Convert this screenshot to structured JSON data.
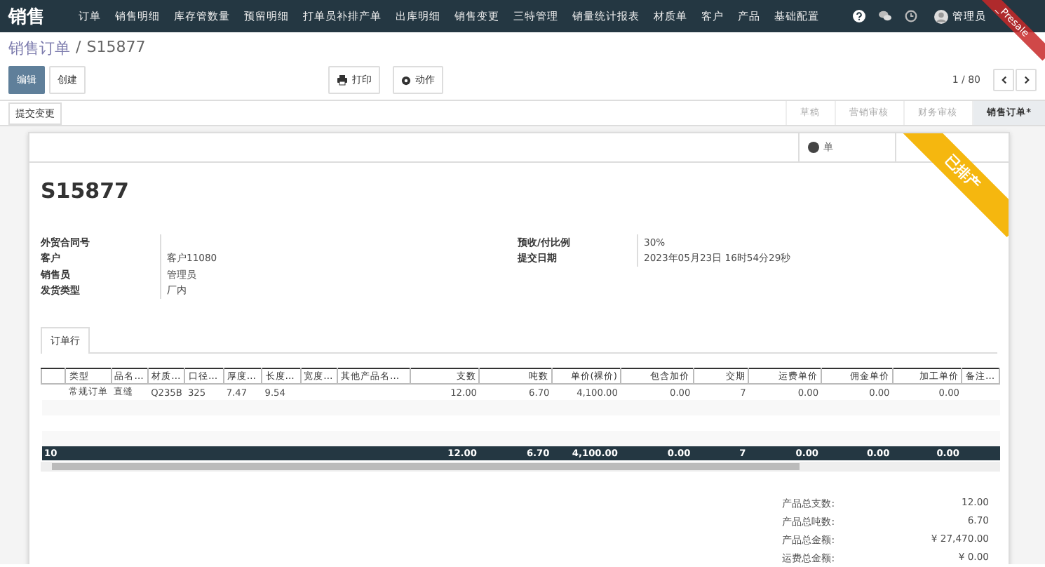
{
  "navbar": {
    "brand": "销售",
    "menu": [
      "订单",
      "销售明细",
      "库存管数量",
      "预留明细",
      "打单员补排产单",
      "出库明细",
      "销售变更",
      "三特管理",
      "销量统计报表",
      "材质单",
      "客户",
      "产品",
      "基础配置"
    ],
    "user": "管理员",
    "ribbon": "_Presale"
  },
  "breadcrumb": {
    "parent": "销售订单",
    "separator": "/",
    "current": "S15877"
  },
  "buttons": [
    {
      "label": "编辑",
      "kind": "primary"
    },
    {
      "label": "创建",
      "kind": "default"
    }
  ],
  "actions": [
    {
      "label": "打印",
      "kind": "print"
    },
    {
      "label": "动作",
      "kind": "gear"
    }
  ],
  "pager": "1 / 80",
  "status_bar": {
    "button": "提交变更",
    "stages": [
      {
        "label": "草稿",
        "selected": false
      },
      {
        "label": "营销审核",
        "selected": false
      },
      {
        "label": "财务审核",
        "selected": false
      },
      {
        "label": "销售订单*",
        "selected": true
      }
    ]
  },
  "smart_button": "单",
  "stamp": "已排产",
  "title": "S15877",
  "fields_left": [
    {
      "label": "外贸合同号"
    },
    {
      "label": "客户",
      "value": "客户11080"
    },
    {
      "label": "销售员",
      "value": "管理员"
    },
    {
      "label": "发货类型",
      "value": "厂内"
    }
  ],
  "fields_right": [
    {
      "label": "预收/付比例",
      "value": "30%"
    },
    {
      "label": "提交日期",
      "value": "2023年05月23日 16时54分29秒"
    }
  ],
  "tab": "订单行",
  "table": {
    "columns": [
      {
        "label": "类型",
        "kind": "text"
      },
      {
        "label": "品名…",
        "kind": "text"
      },
      {
        "label": "材质…",
        "kind": "text"
      },
      {
        "label": "口径…",
        "kind": "text"
      },
      {
        "label": "厚度…",
        "kind": "text"
      },
      {
        "label": "长度…",
        "kind": "text"
      },
      {
        "label": "宽度…",
        "kind": "text"
      },
      {
        "label": "其他产品名…",
        "kind": "text"
      },
      {
        "label": "支数",
        "kind": "number"
      },
      {
        "label": "吨数",
        "kind": "number"
      },
      {
        "label": "单价(裸价)",
        "kind": "number"
      },
      {
        "label": "包含加价",
        "kind": "number"
      },
      {
        "label": "交期",
        "kind": "number"
      },
      {
        "label": "运费单价",
        "kind": "number"
      },
      {
        "label": "佣金单价",
        "kind": "number"
      },
      {
        "label": "加工单价",
        "kind": "number"
      },
      {
        "label": "备注…",
        "kind": "text"
      }
    ],
    "rows": [
      [
        "常规订单",
        "直缝",
        "Q235B",
        "325",
        "7.47",
        "9.54",
        "",
        "",
        "12.00",
        "6.70",
        "4,100.00",
        "0.00",
        "7",
        "0.00",
        "0.00",
        "0.00",
        ""
      ]
    ],
    "footer": {
      "count": "10",
      "cells": [
        "",
        "",
        "",
        "",
        "",
        "",
        "",
        "",
        "12.00",
        "6.70",
        "4,100.00",
        "0.00",
        "7",
        "0.00",
        "0.00",
        "0.00",
        ""
      ]
    }
  },
  "totals": [
    {
      "label": "产品总支数:",
      "value": "12.00"
    },
    {
      "label": "产品总吨数:",
      "value": "6.70"
    },
    {
      "label": "产品总金额:",
      "value": "¥ 27,470.00"
    },
    {
      "label": "运费总金额:",
      "value": "¥ 0.00"
    }
  ]
}
